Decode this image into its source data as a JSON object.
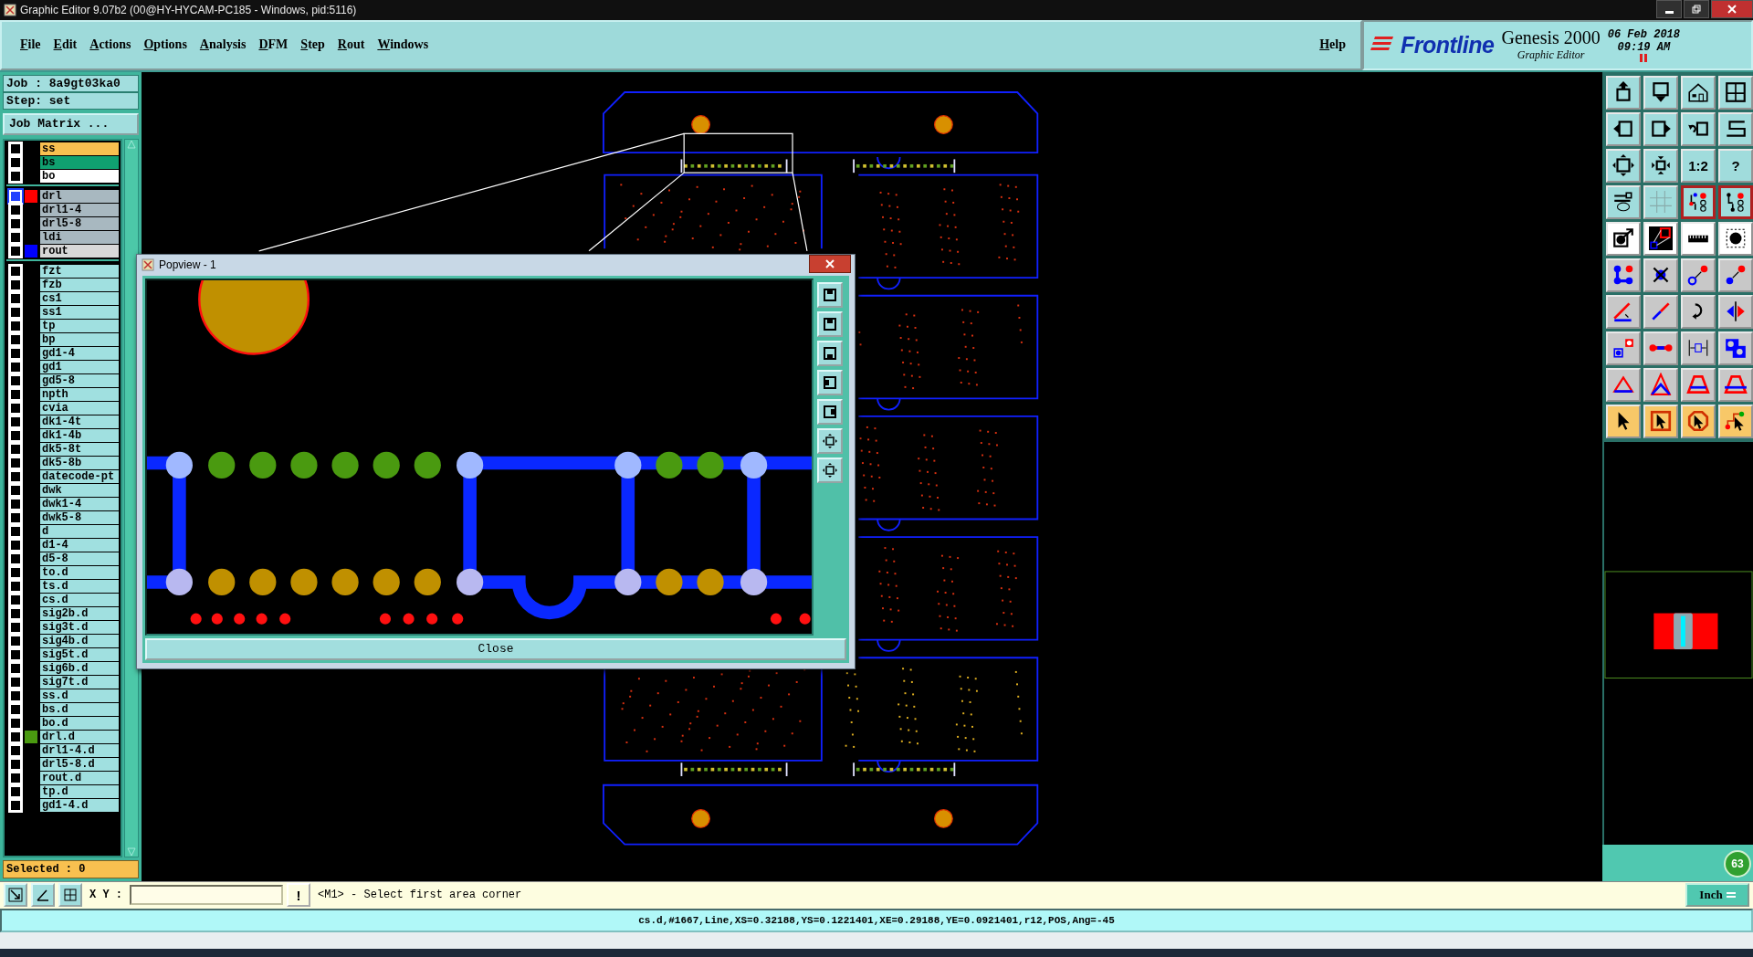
{
  "window": {
    "title": "Graphic Editor 9.07b2 (00@HY-HYCAM-PC185 - Windows, pid:5116)"
  },
  "menu": [
    "File",
    "Edit",
    "Actions",
    "Options",
    "Analysis",
    "DFM",
    "Step",
    "Rout",
    "Windows"
  ],
  "help": "Help",
  "branding": {
    "company": "Frontline",
    "product": "Genesis 2000",
    "module": "Graphic Editor",
    "date": "06 Feb 2018",
    "time": "09:19 AM"
  },
  "job": {
    "job": "Job : 8a9gt03ka0",
    "step": "Step: set",
    "matrix_button": "Job Matrix ..."
  },
  "layer_groups": [
    {
      "layers": [
        {
          "name": "ss",
          "kind": "mask_top",
          "selected": false
        },
        {
          "name": "bs",
          "kind": "mask_bottom",
          "selected": false
        },
        {
          "name": "bo",
          "kind": "overlay",
          "selected": false
        }
      ]
    },
    {
      "layers": [
        {
          "name": "drl",
          "kind": "drill",
          "color": "#ff0000",
          "selected": true
        },
        {
          "name": "drl1-4",
          "kind": "drill",
          "selected": false
        },
        {
          "name": "drl5-8",
          "kind": "drill",
          "selected": false
        },
        {
          "name": "ldi",
          "kind": "drill",
          "selected": false
        },
        {
          "name": "rout",
          "kind": "rout",
          "color": "#0000ff",
          "selected": false
        }
      ]
    },
    {
      "layers": [
        {
          "name": "fzt",
          "kind": "document",
          "selected": false
        },
        {
          "name": "fzb",
          "kind": "document",
          "selected": false
        },
        {
          "name": "cs1",
          "kind": "document",
          "selected": false
        },
        {
          "name": "ss1",
          "kind": "document",
          "selected": false
        },
        {
          "name": "tp",
          "kind": "document",
          "selected": false
        },
        {
          "name": "bp",
          "kind": "document",
          "selected": false
        },
        {
          "name": "gd1-4",
          "kind": "document",
          "selected": false
        },
        {
          "name": "gd1",
          "kind": "document",
          "selected": false
        },
        {
          "name": "gd5-8",
          "kind": "document",
          "selected": false
        },
        {
          "name": "npth",
          "kind": "document",
          "selected": false
        },
        {
          "name": "cvia",
          "kind": "document",
          "selected": false
        },
        {
          "name": "dk1-4t",
          "kind": "document",
          "selected": false
        },
        {
          "name": "dk1-4b",
          "kind": "document",
          "selected": false
        },
        {
          "name": "dk5-8t",
          "kind": "document",
          "selected": false
        },
        {
          "name": "dk5-8b",
          "kind": "document",
          "selected": false
        },
        {
          "name": "datecode-pt",
          "kind": "document",
          "selected": false
        },
        {
          "name": "dwk",
          "kind": "document",
          "selected": false
        },
        {
          "name": "dwk1-4",
          "kind": "document",
          "selected": false
        },
        {
          "name": "dwk5-8",
          "kind": "document",
          "selected": false
        },
        {
          "name": "d",
          "kind": "document",
          "selected": false
        },
        {
          "name": "d1-4",
          "kind": "document",
          "selected": false
        },
        {
          "name": "d5-8",
          "kind": "document",
          "selected": false
        },
        {
          "name": "to.d",
          "kind": "document",
          "selected": false
        },
        {
          "name": "ts.d",
          "kind": "document",
          "selected": false
        },
        {
          "name": "cs.d",
          "kind": "document",
          "selected": false
        },
        {
          "name": "sig2b.d",
          "kind": "document",
          "selected": false
        },
        {
          "name": "sig3t.d",
          "kind": "document",
          "selected": false
        },
        {
          "name": "sig4b.d",
          "kind": "document",
          "selected": false
        },
        {
          "name": "sig5t.d",
          "kind": "document",
          "selected": false
        },
        {
          "name": "sig6b.d",
          "kind": "document",
          "selected": false
        },
        {
          "name": "sig7t.d",
          "kind": "document",
          "selected": false
        },
        {
          "name": "ss.d",
          "kind": "document",
          "selected": false
        },
        {
          "name": "bs.d",
          "kind": "document",
          "selected": false
        },
        {
          "name": "bo.d",
          "kind": "document",
          "selected": false
        },
        {
          "name": "drl.d",
          "kind": "document",
          "color": "#4a9a10",
          "selected": false
        },
        {
          "name": "drl1-4.d",
          "kind": "document",
          "selected": false
        },
        {
          "name": "drl5-8.d",
          "kind": "document",
          "selected": false
        },
        {
          "name": "rout.d",
          "kind": "document",
          "selected": false
        },
        {
          "name": "tp.d",
          "kind": "document",
          "selected": false
        },
        {
          "name": "gd1-4.d",
          "kind": "document",
          "selected": false
        }
      ]
    }
  ],
  "selected_count": "Selected : 0",
  "toolbar": [
    {
      "kind": "view",
      "on": false
    },
    {
      "kind": "view",
      "on": false
    },
    {
      "kind": "view",
      "on": false
    },
    {
      "kind": "view",
      "on": false
    },
    {
      "kind": "view",
      "on": false
    },
    {
      "kind": "view",
      "on": false
    },
    {
      "kind": "view",
      "on": false
    },
    {
      "kind": "view",
      "on": false
    },
    {
      "kind": "view",
      "on": false
    },
    {
      "kind": "view",
      "on": false
    },
    {
      "kind": "view",
      "on": false,
      "label": "1:2"
    },
    {
      "kind": "view",
      "on": false,
      "label": "?"
    },
    {
      "kind": "view",
      "on": false
    },
    {
      "kind": "view",
      "on": false
    },
    {
      "kind": "view",
      "on": true
    },
    {
      "kind": "view",
      "on": true
    },
    {
      "kind": "snap",
      "on": false
    },
    {
      "kind": "snap",
      "on": false
    },
    {
      "kind": "snap",
      "on": false
    },
    {
      "kind": "snap",
      "on": false
    },
    {
      "kind": "edit",
      "on": false
    },
    {
      "kind": "edit",
      "on": false
    },
    {
      "kind": "edit",
      "on": false
    },
    {
      "kind": "edit",
      "on": false
    },
    {
      "kind": "edit",
      "on": false
    },
    {
      "kind": "edit",
      "on": false
    },
    {
      "kind": "edit",
      "on": false
    },
    {
      "kind": "edit",
      "on": false
    },
    {
      "kind": "edit",
      "on": false
    },
    {
      "kind": "edit",
      "on": false
    },
    {
      "kind": "edit",
      "on": false
    },
    {
      "kind": "edit",
      "on": false
    },
    {
      "kind": "edit",
      "on": false
    },
    {
      "kind": "edit",
      "on": false
    },
    {
      "kind": "edit",
      "on": false
    },
    {
      "kind": "edit",
      "on": false
    },
    {
      "kind": "select",
      "on": false
    },
    {
      "kind": "select",
      "on": false
    },
    {
      "kind": "select",
      "on": false
    },
    {
      "kind": "select",
      "on": false
    }
  ],
  "popview": {
    "title": "Popview - 1",
    "close_button": "Close"
  },
  "command_bar": {
    "xy_label": "X Y :",
    "alert_button": "!",
    "prompt": "<M1> - Select first area corner",
    "units": "Inch"
  },
  "status_line": "cs.d,#1667,Line,XS=0.32188,YS=0.1221401,XE=0.29188,YE=0.0921401,r12,POS,Ang=-45",
  "badge": "63"
}
